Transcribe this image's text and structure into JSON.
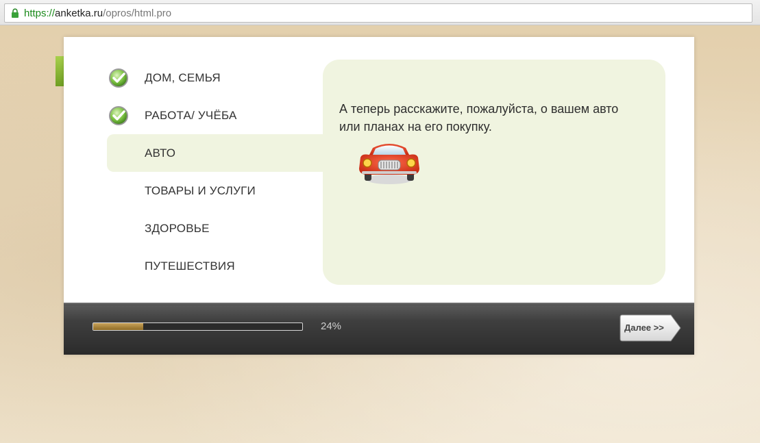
{
  "browser": {
    "url_scheme": "https://",
    "url_host": "anketka.ru",
    "url_path": "/opros/html.pro"
  },
  "survey": {
    "sections": [
      {
        "label": "ДОМ, СЕМЬЯ",
        "status": "done"
      },
      {
        "label": "РАБОТА/ УЧЁБА",
        "status": "done"
      },
      {
        "label": "АВТО",
        "status": "active"
      },
      {
        "label": "ТОВАРЫ И УСЛУГИ",
        "status": "pending"
      },
      {
        "label": "ЗДОРОВЬЕ",
        "status": "pending"
      },
      {
        "label": "ПУТЕШЕСТВИЯ",
        "status": "pending"
      }
    ],
    "question": "А теперь расскажите, пожалуйста, о вашем авто или планах на его покупку.",
    "progress": {
      "percent": 24,
      "label": "24%"
    },
    "next_label": "Далее >>"
  },
  "colors": {
    "accent_green": "#8dbb3a",
    "panel_bg": "#f0f4e0",
    "progress_fill": "#b48a3a"
  }
}
